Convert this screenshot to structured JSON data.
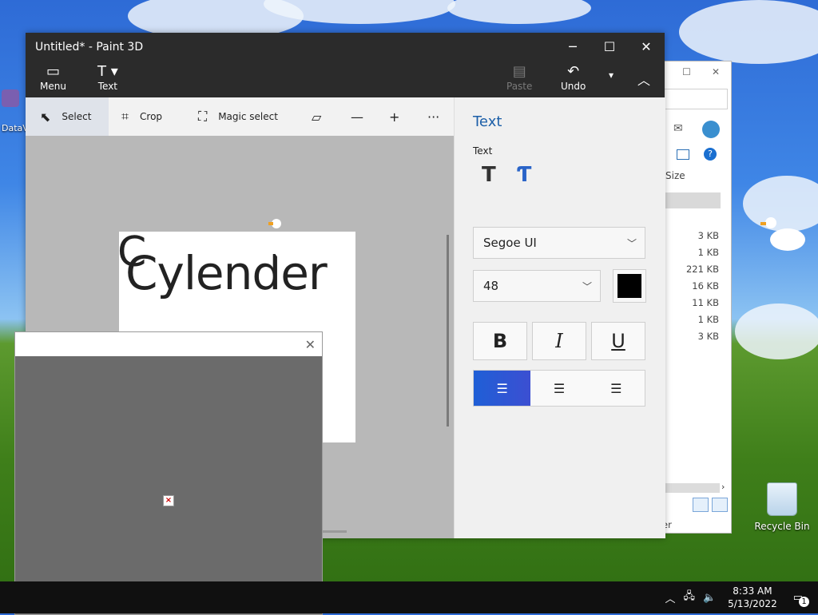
{
  "paint": {
    "title": "Untitled* - Paint 3D",
    "win_minimize": "─",
    "win_maximize": "☐",
    "win_close": "✕",
    "top_menu": {
      "menu_label": "Menu",
      "text_label": "Text"
    },
    "paste_label": "Paste",
    "undo_label": "Undo",
    "toolbar": {
      "select_label": "Select",
      "crop_label": "Crop",
      "magic_select_label": "Magic select"
    },
    "canvas_text": "Cylender",
    "canvas_stray": "C"
  },
  "text_panel": {
    "title": "Text",
    "section_label": "Text",
    "font": "Segoe UI",
    "size": "48",
    "color": "#000000",
    "bold": "B",
    "italic": "I",
    "underline": "U",
    "alignment": "left"
  },
  "explorer": {
    "size_header": "Size",
    "sizes": [
      "3 KB",
      "1 KB",
      "221 KB",
      "16 KB",
      "11 KB",
      "1 KB",
      "3 KB"
    ],
    "status_fragment": "er"
  },
  "desktop": {
    "recycle_bin": "Recycle Bin",
    "data_icon": "DataV"
  },
  "taskbar": {
    "time": "8:33 AM",
    "date": "5/13/2022",
    "notification_count": "1"
  }
}
